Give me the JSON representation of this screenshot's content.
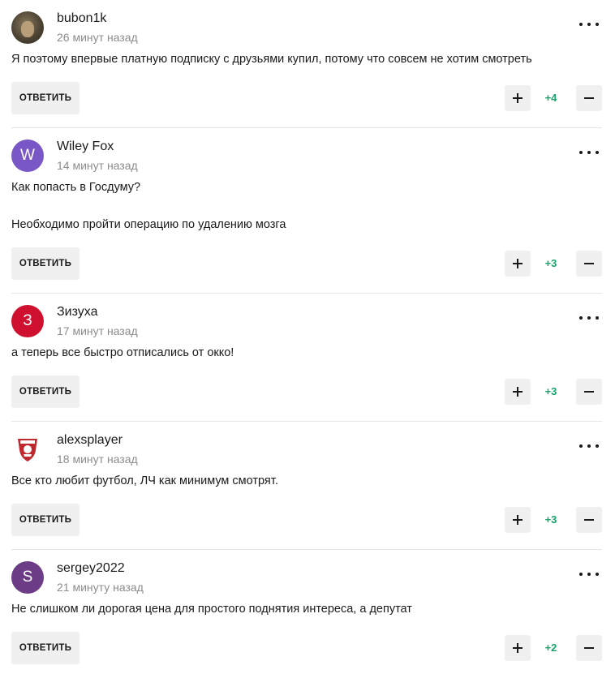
{
  "reply_label": "ОТВЕТИТЬ",
  "colors": {
    "score": "#1aa36a",
    "muted": "#8c8c8c",
    "button_bg": "#f0f0f0"
  },
  "comments": [
    {
      "author": "bubon1k",
      "time": "26 минут назад",
      "avatar": {
        "kind": "photo"
      },
      "text": [
        "Я поэтому впервые платную подписку с друзьями купил, потому что совсем не хотим смотреть"
      ],
      "score": "+4"
    },
    {
      "author": "Wiley Fox",
      "time": "14 минут назад",
      "avatar": {
        "kind": "letter",
        "letter": "W",
        "color": "#7a57c6"
      },
      "text": [
        "Как попасть в Госдуму?",
        "Необходимо пройти операцию по удалению мозга"
      ],
      "score": "+3"
    },
    {
      "author": "Зизуха",
      "time": "17 минут назад",
      "avatar": {
        "kind": "letter",
        "letter": "З",
        "color": "#d0102f"
      },
      "text": [
        "а теперь все быстро отписались от окко!"
      ],
      "score": "+3"
    },
    {
      "author": "alexsplayer",
      "time": "18 минут назад",
      "avatar": {
        "kind": "badge",
        "icon": "club-crest-icon",
        "color": "#c0282d"
      },
      "text": [
        "Все кто любит футбол, ЛЧ как минимум смотрят."
      ],
      "score": "+3"
    },
    {
      "author": "sergey2022",
      "time": "21 минуту назад",
      "avatar": {
        "kind": "letter",
        "letter": "S",
        "color": "#6d3c86"
      },
      "text": [
        "Не слишком ли дорогая цена для простого поднятия интереса, а депутат"
      ],
      "score": "+2"
    }
  ]
}
